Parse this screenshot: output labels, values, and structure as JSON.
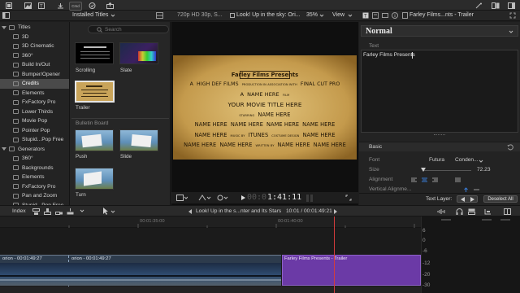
{
  "toolbar": {
    "cmd_label": "Cmd"
  },
  "browser": {
    "title": "Installed Titles",
    "search_placeholder": "Search",
    "section_header": "Bulletin Board",
    "items": [
      {
        "label": "Scrolling"
      },
      {
        "label": "Slate"
      },
      {
        "label": "Trailer"
      },
      {
        "label": "Push"
      },
      {
        "label": "Slide"
      },
      {
        "label": "Turn"
      }
    ]
  },
  "sidebar": {
    "items": [
      {
        "label": "Titles",
        "type": "category"
      },
      {
        "label": "3D"
      },
      {
        "label": "3D Cinematic"
      },
      {
        "label": "360°"
      },
      {
        "label": "Build In/Out"
      },
      {
        "label": "Bumper/Opener"
      },
      {
        "label": "Credits",
        "selected": true
      },
      {
        "label": "Elements"
      },
      {
        "label": "FxFactory Pro"
      },
      {
        "label": "Lower Thirds"
      },
      {
        "label": "Movie Pop"
      },
      {
        "label": "Pointer Pop"
      },
      {
        "label": "Stupid...Pop Free"
      },
      {
        "label": "Generators",
        "type": "category"
      },
      {
        "label": "360°"
      },
      {
        "label": "Backgrounds"
      },
      {
        "label": "Elements"
      },
      {
        "label": "FxFactory Pro"
      },
      {
        "label": "Pan and Zoom"
      },
      {
        "label": "Stupid...Pop Free"
      }
    ]
  },
  "viewer": {
    "format": "720p HD 30p, S...",
    "clip_title": "Look! Up in the sky: Ori...",
    "zoom": "35%",
    "view_label": "View",
    "timecode_dim": "00:0",
    "timecode": "1:41:11",
    "poster": {
      "header": "Farley Films Presents",
      "lines": [
        {
          "parts": [
            "A",
            "HIGH DEF FILMS",
            "PRODUCTION IN ASSOCIATION WITH",
            "FINAL CUT PRO"
          ]
        },
        {
          "parts": [
            "A",
            "NAME HERE",
            "FILM"
          ]
        },
        {
          "parts": [
            "YOUR MOVIE TITLE HERE"
          ]
        },
        {
          "parts": [
            "STARRING",
            "NAME HERE"
          ]
        },
        {
          "parts": [
            "NAME HERE",
            "NAME HERE",
            "NAME HERE",
            "NAME HERE"
          ]
        },
        {
          "parts": [
            "NAME HERE",
            "MUSIC BY",
            "ITUNES",
            "COSTUME DESIGN",
            "NAME HERE"
          ]
        },
        {
          "parts": [
            "NAME HERE",
            "NAME HERE",
            "WRITTEN BY",
            "NAME HERE",
            "NAME HERE"
          ]
        }
      ]
    }
  },
  "inspector": {
    "clip_title": "Farley Films...nts - Trailer",
    "style_name": "Normal",
    "text_section": "Text",
    "text_value": "Farley Films Presents",
    "basic_label": "Basic",
    "font_label": "Font",
    "font_value": "Futura",
    "font_style": "Conden...",
    "size_label": "Size",
    "size_value": "72.23",
    "alignment_label": "Alignment",
    "vertical_label": "Vertical Alignme...",
    "text_layer_label": "Text Layer:",
    "deselect_label": "Deselect All"
  },
  "timeline": {
    "index_label": "Index",
    "project_title": "Look! Up in the s...nter and Its Stars",
    "position": "10:01 / 00:01:49:21",
    "ruler_marks": [
      "00:01:35:00",
      "00:01:40:00"
    ],
    "clip_a_label": "orion - 00:01:49:27",
    "clip_a2_label": "orion - 00:01:49:27",
    "clip_b_label": "Farley Films Presents - Trailer"
  },
  "meters": {
    "labels": [
      "6",
      "0",
      "-6",
      "-12",
      "-20",
      "-30"
    ]
  },
  "colors": {
    "selection": "#4a4a4a",
    "accent_blue": "#3a7bd5",
    "title_clip": "#6b3aa6",
    "poster_bg": "#c9a45a"
  }
}
